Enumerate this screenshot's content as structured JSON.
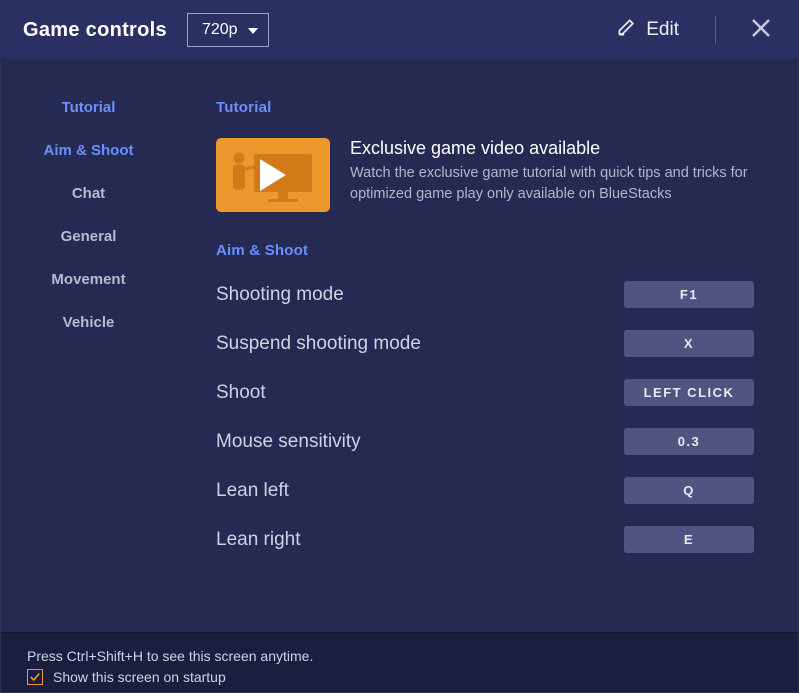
{
  "header": {
    "title": "Game controls",
    "resolution": "720p",
    "edit_label": "Edit"
  },
  "sidebar": {
    "items": [
      {
        "label": "Tutorial",
        "active": true
      },
      {
        "label": "Aim & Shoot",
        "active": true
      },
      {
        "label": "Chat",
        "active": false
      },
      {
        "label": "General",
        "active": false
      },
      {
        "label": "Movement",
        "active": false
      },
      {
        "label": "Vehicle",
        "active": false
      }
    ]
  },
  "content": {
    "tutorial_label": "Tutorial",
    "video_title": "Exclusive game video available",
    "video_desc": "Watch the exclusive game tutorial with quick tips and tricks for optimized game play only available on BlueStacks",
    "aimshoot_label": "Aim & Shoot",
    "rows": [
      {
        "label": "Shooting mode",
        "key": "F1"
      },
      {
        "label": "Suspend shooting mode",
        "key": "X"
      },
      {
        "label": "Shoot",
        "key": "LEFT CLICK"
      },
      {
        "label": "Mouse sensitivity",
        "key": "0.3"
      },
      {
        "label": "Lean left",
        "key": "Q"
      },
      {
        "label": "Lean right",
        "key": "E"
      }
    ]
  },
  "footer": {
    "hint": "Press Ctrl+Shift+H to see this screen anytime.",
    "show_on_startup": "Show this screen on startup",
    "checked": true
  }
}
